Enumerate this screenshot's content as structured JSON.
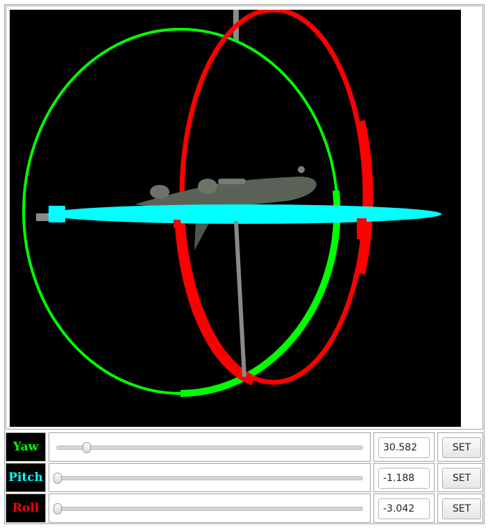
{
  "colors": {
    "yaw": "#00ff00",
    "pitch": "#00ffff",
    "roll": "#ff0000",
    "viewport_bg": "#000000"
  },
  "viewport": {
    "content": "3d-gimbal-aircraft-scene"
  },
  "controls": [
    {
      "key": "yaw",
      "label": "Yaw",
      "value": "30.582",
      "slider_fraction": 0.097,
      "button": "SET"
    },
    {
      "key": "pitch",
      "label": "Pitch",
      "value": "-1.188",
      "slider_fraction": 0.003,
      "button": "SET"
    },
    {
      "key": "roll",
      "label": "Roll",
      "value": "-3.042",
      "slider_fraction": 0.003,
      "button": "SET"
    }
  ]
}
